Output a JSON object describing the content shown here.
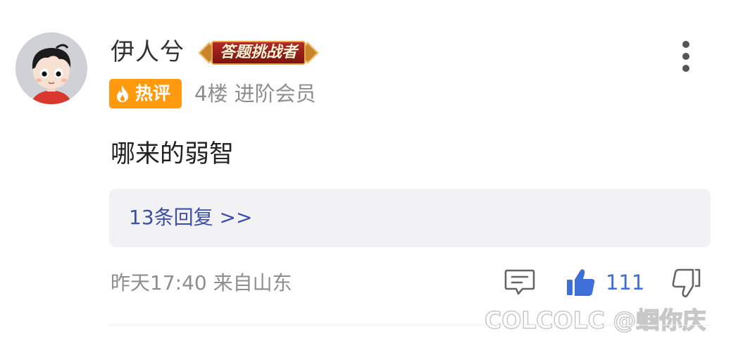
{
  "user": {
    "name": "伊人兮",
    "badge_label": "答题挑战者",
    "hot_label": "热评",
    "floor": "4楼",
    "member_level": "进阶会员"
  },
  "comment": {
    "text": "哪来的弱智"
  },
  "replies": {
    "label": "13条回复 >>"
  },
  "footer": {
    "time_location": "昨天17:40 来自山东",
    "like_count": "111"
  },
  "watermark": {
    "text": "COLCOLC @蝈你庆"
  },
  "icons": {
    "avatar": "avatar-image",
    "more": "more-vertical-icon",
    "hot": "flame-icon",
    "reply": "comment-icon",
    "like": "thumbs-up-icon",
    "dislike": "thumbs-down-icon"
  },
  "colors": {
    "hot_badge": "#ff9a0e",
    "link": "#3c4fa8",
    "like": "#3e6fd8",
    "badge_red": "#b12a24"
  }
}
